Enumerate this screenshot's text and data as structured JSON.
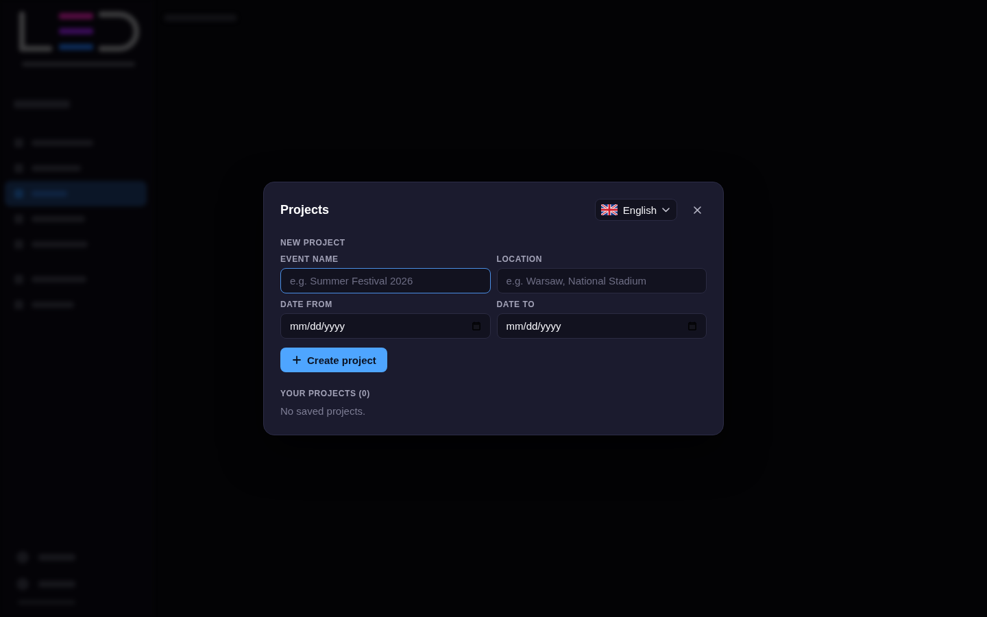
{
  "sidebar": {
    "nav_groups": [
      {
        "items": [
          {
            "selected": false
          },
          {
            "selected": false
          },
          {
            "selected": true
          },
          {
            "selected": false
          },
          {
            "selected": false
          }
        ]
      },
      {
        "items": [
          {
            "selected": false
          },
          {
            "selected": false
          }
        ]
      }
    ],
    "footer_items": [
      {
        "selected": false
      },
      {
        "selected": false
      }
    ]
  },
  "dialog": {
    "title": "Projects",
    "language": {
      "value": "English"
    },
    "section_label": "NEW PROJECT",
    "fields": [
      {
        "kind": "text",
        "label": "EVENT NAME",
        "placeholder": "e.g. Summer Festival 2026",
        "focused": true
      },
      {
        "kind": "text",
        "label": "LOCATION",
        "placeholder": "e.g. Warsaw, National Stadium",
        "focused": false
      },
      {
        "kind": "date",
        "label": "DATE FROM",
        "placeholder": "mm/dd/yyyy",
        "focused": false
      },
      {
        "kind": "date",
        "label": "DATE TO",
        "placeholder": "mm/dd/yyyy",
        "focused": false
      }
    ],
    "create_button": "Create project",
    "projects_heading": "YOUR PROJECTS (0)",
    "empty_message": "No saved projects."
  }
}
